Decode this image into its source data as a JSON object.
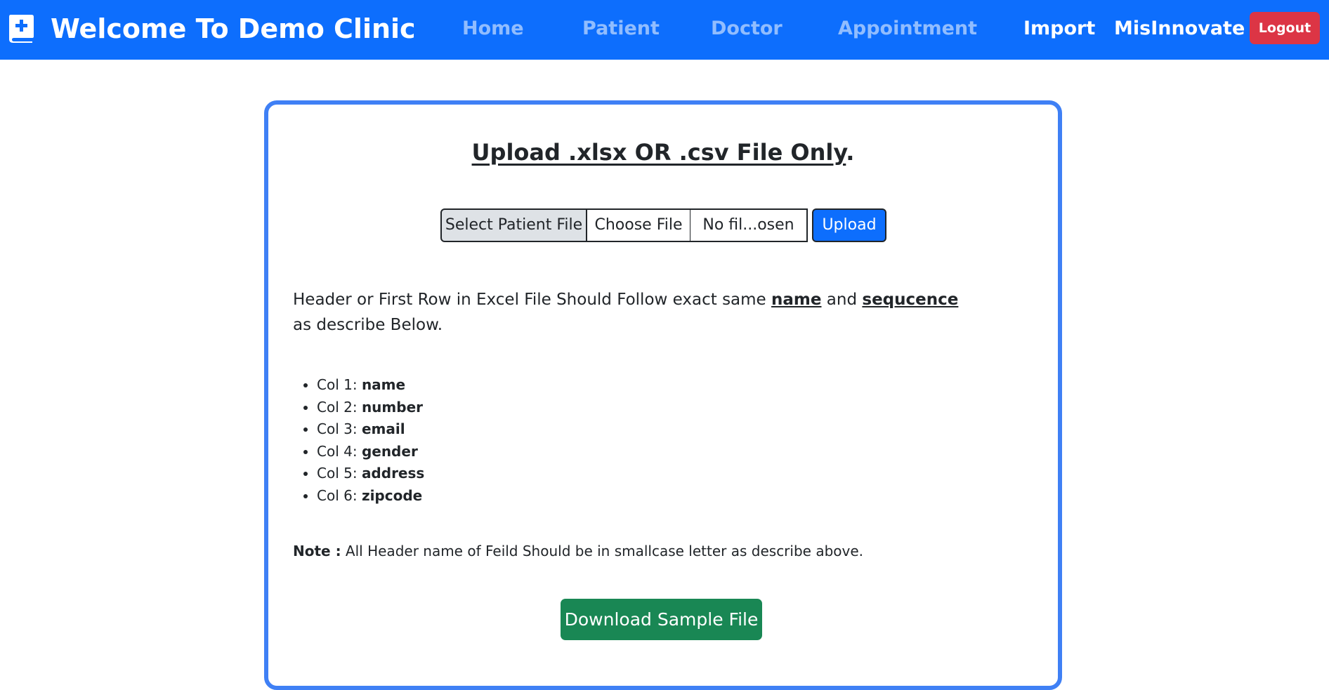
{
  "nav": {
    "brand_icon": "medical-book-icon",
    "title": "Welcome To Demo Clinic",
    "links": [
      {
        "label": "Home"
      },
      {
        "label": "Patient"
      },
      {
        "label": "Doctor"
      },
      {
        "label": "Appointment"
      },
      {
        "label": "Import"
      },
      {
        "label": "MisInnovate"
      }
    ],
    "logout_label": "Logout"
  },
  "upload": {
    "title": "Upload .xlsx OR .csv File Only",
    "title_suffix": ".",
    "file_label": "Select Patient File",
    "choose_label": "Choose File",
    "file_name": "No fil...osen",
    "upload_label": "Upload"
  },
  "instructions": {
    "part1": "Header or First Row in Excel File Should Follow exact same ",
    "name_word": "name",
    "and_word": " and ",
    "sequence_word": "sequcence",
    "part2": " as describe Below.",
    "columns": [
      {
        "prefix": "Col 1: ",
        "name": "name"
      },
      {
        "prefix": "Col 2: ",
        "name": "number"
      },
      {
        "prefix": "Col 3: ",
        "name": "email"
      },
      {
        "prefix": "Col 4: ",
        "name": "gender"
      },
      {
        "prefix": "Col 5: ",
        "name": "address"
      },
      {
        "prefix": "Col 6: ",
        "name": "zipcode"
      }
    ],
    "note_label": "Note :",
    "note_text": " All Header name of Feild Should be in smallcase letter as describe above."
  },
  "download_label": "Download Sample File",
  "colors": {
    "navbar": "#0d6efd",
    "logout": "#dc3545",
    "card_border": "#3f80f5",
    "download": "#198754"
  }
}
